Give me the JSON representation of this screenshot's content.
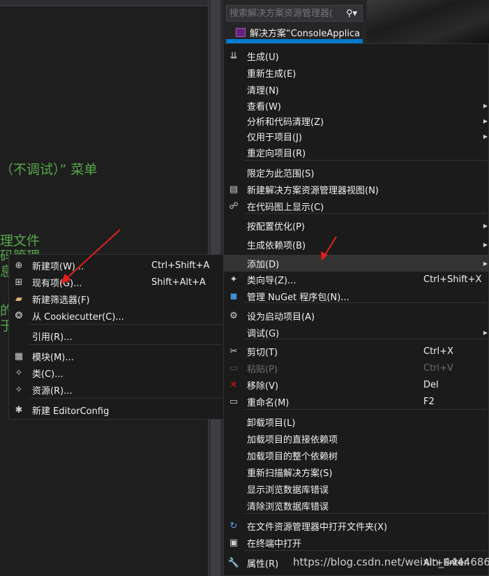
{
  "editor": {
    "lines": [
      "（不调试）” 菜单",
      "理文件",
      "码管理",
      "息",
      "的",
      "于"
    ]
  },
  "solution_explorer": {
    "search_placeholder": "搜索解决方案资源管理器(",
    "search_icon": "search-icon",
    "root_item": "解决方案“ConsoleApplica"
  },
  "context_menu": {
    "items": [
      {
        "label": "生成(U)",
        "icon": "build-icon"
      },
      {
        "label": "重新生成(E)"
      },
      {
        "label": "清理(N)"
      },
      {
        "label": "查看(W)",
        "submenu": true
      },
      {
        "label": "分析和代码清理(Z)",
        "submenu": true
      },
      {
        "label": "仅用于项目(J)",
        "submenu": true
      },
      {
        "label": "重定向项目(R)"
      },
      {
        "label": "限定为此范围(S)"
      },
      {
        "label": "新建解决方案资源管理器视图(N)",
        "icon": "new-view-icon"
      },
      {
        "label": "在代码图上显示(C)",
        "icon": "code-map-icon"
      },
      {
        "label": "按配置优化(P)",
        "submenu": true
      },
      {
        "label": "生成依赖项(B)",
        "submenu": true
      },
      {
        "label": "添加(D)",
        "submenu": true,
        "highlighted": true
      },
      {
        "label": "类向导(Z)...",
        "shortcut": "Ctrl+Shift+X",
        "icon": "class-wizard-icon"
      },
      {
        "label": "管理 NuGet 程序包(N)...",
        "icon": "nuget-icon"
      },
      {
        "label": "设为启动项目(A)",
        "icon": "gear-icon"
      },
      {
        "label": "调试(G)",
        "submenu": true
      },
      {
        "label": "剪切(T)",
        "shortcut": "Ctrl+X",
        "icon": "cut-icon"
      },
      {
        "label": "粘贴(P)",
        "shortcut": "Ctrl+V",
        "icon": "paste-icon",
        "disabled": true
      },
      {
        "label": "移除(V)",
        "shortcut": "Del",
        "icon": "remove-icon"
      },
      {
        "label": "重命名(M)",
        "shortcut": "F2",
        "icon": "rename-icon"
      },
      {
        "label": "卸载项目(L)"
      },
      {
        "label": "加载项目的直接依赖项"
      },
      {
        "label": "加载项目的整个依赖树"
      },
      {
        "label": "重新扫描解决方案(S)"
      },
      {
        "label": "显示浏览数据库错误"
      },
      {
        "label": "清除浏览数据库错误"
      },
      {
        "label": "在文件资源管理器中打开文件夹(X)",
        "icon": "open-folder-icon"
      },
      {
        "label": "在终端中打开",
        "icon": "terminal-icon"
      },
      {
        "label": "属性(R)",
        "shortcut": "Alt+Enter",
        "icon": "wrench-icon"
      }
    ]
  },
  "add_submenu": {
    "items": [
      {
        "label": "新建项(W)...",
        "shortcut": "Ctrl+Shift+A",
        "icon": "new-item-icon"
      },
      {
        "label": "现有项(G)...",
        "shortcut": "Shift+Alt+A",
        "icon": "existing-item-icon"
      },
      {
        "label": "新建筛选器(F)",
        "icon": "new-filter-icon"
      },
      {
        "label": "从 Cookiecutter(C)...",
        "icon": "cookiecutter-icon"
      },
      {
        "label": "引用(R)..."
      },
      {
        "label": "模块(M)...",
        "icon": "module-icon"
      },
      {
        "label": "类(C)...",
        "icon": "class-icon"
      },
      {
        "label": "资源(R)...",
        "icon": "resource-icon"
      },
      {
        "label": "新建 EditorConfig",
        "icon": "editorconfig-icon"
      }
    ]
  },
  "watermark": "https://blog.csdn.net/weixin_44446861",
  "colors": {
    "comment": "#57a64a",
    "accent": "#007acc",
    "arrow": "#e02020"
  }
}
